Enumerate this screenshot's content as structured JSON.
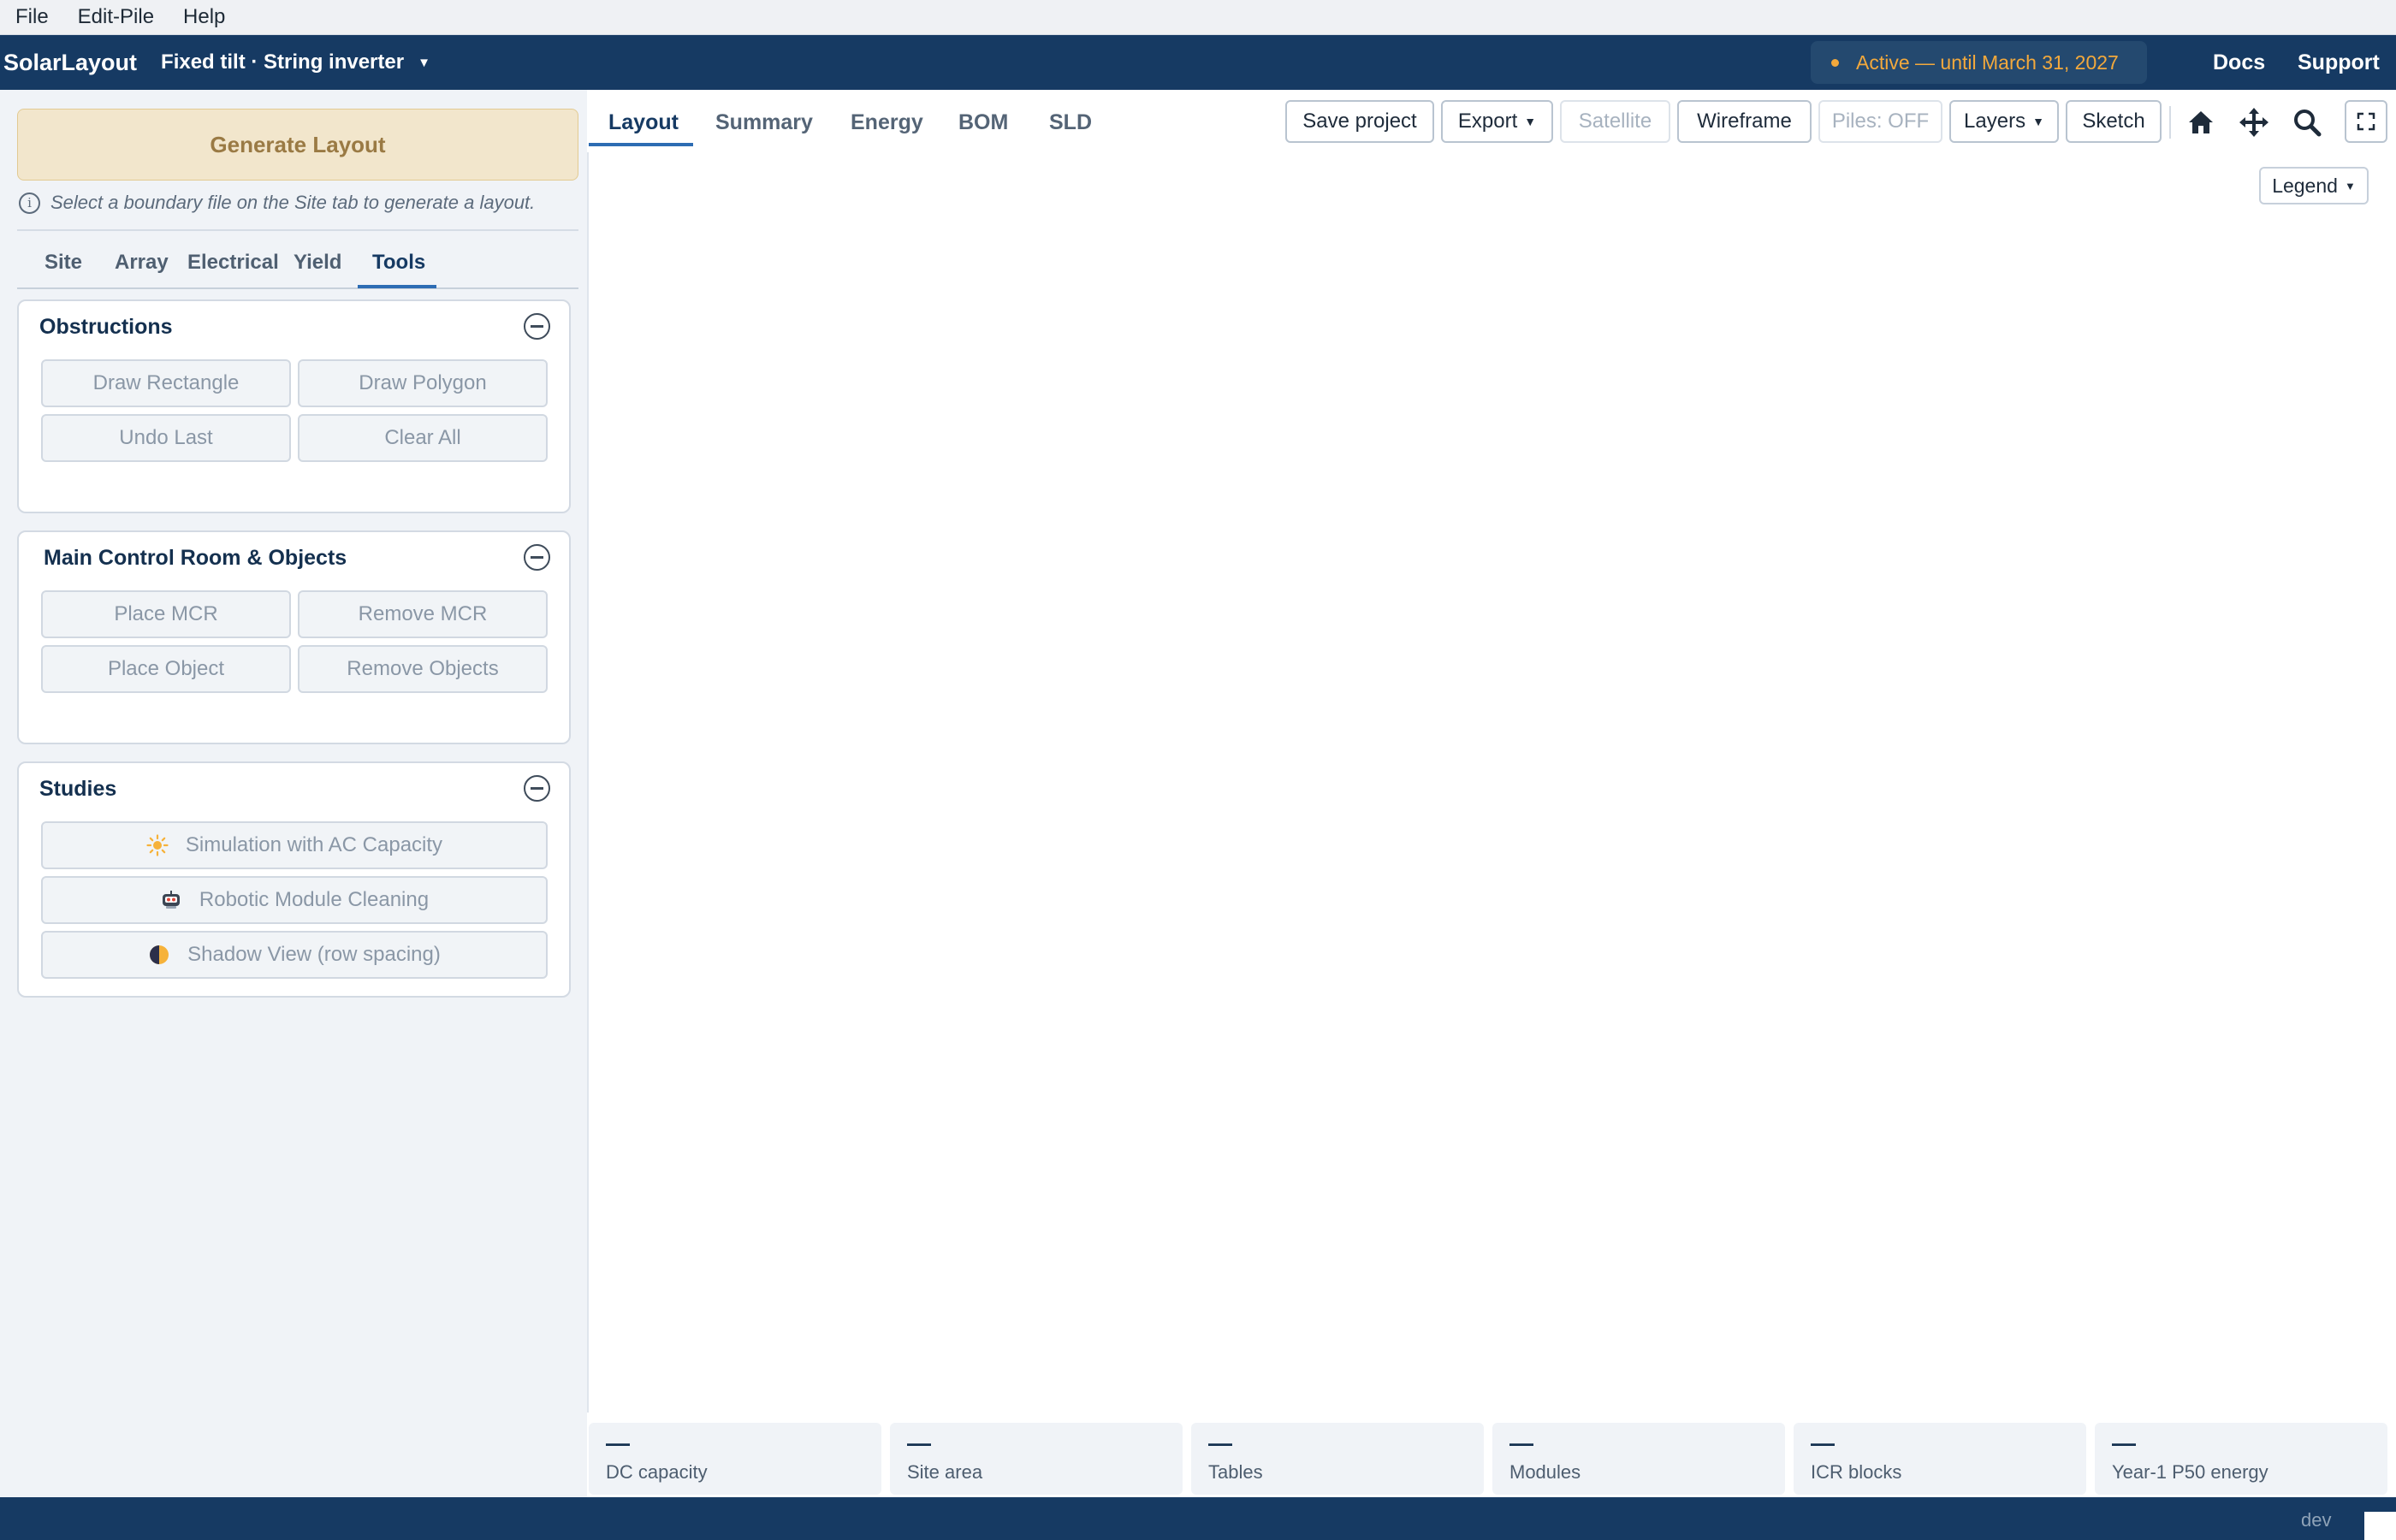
{
  "menu": [
    "File",
    "Edit-Pile",
    "Help"
  ],
  "header": {
    "brand": "SolarLayout",
    "mode": "Fixed tilt · String inverter",
    "license": "Active — until March 31, 2027",
    "docs": "Docs",
    "support": "Support",
    "accent": "#f3a93c",
    "bar_color": "#163a63"
  },
  "left": {
    "generate": "Generate Layout",
    "hint": "Select a boundary file on the Site tab to generate a layout.",
    "tabs": [
      "Site",
      "Array",
      "Electrical",
      "Yield",
      "Tools"
    ],
    "active_tab": "Tools",
    "obstructions": {
      "title": "Obstructions",
      "buttons": [
        "Draw Rectangle",
        "Draw Polygon",
        "Undo Last",
        "Clear All"
      ]
    },
    "mcr": {
      "title": "Main Control Room & Objects",
      "buttons": [
        "Place MCR",
        "Remove MCR",
        "Place Object",
        "Remove Objects"
      ]
    },
    "studies": {
      "title": "Studies",
      "items": [
        {
          "label": "Simulation with AC Capacity",
          "icon": "sun-icon"
        },
        {
          "label": "Robotic Module Cleaning",
          "icon": "robot-icon"
        },
        {
          "label": "Shadow View (row spacing)",
          "icon": "half-moon-icon"
        }
      ]
    }
  },
  "tabs": [
    "Layout",
    "Summary",
    "Energy",
    "BOM",
    "SLD"
  ],
  "active_tab": "Layout",
  "toolbar": {
    "save": "Save project",
    "export": "Export",
    "satellite": "Satellite",
    "wireframe": "Wireframe",
    "piles": "Piles: OFF",
    "layers": "Layers",
    "sketch": "Sketch",
    "icons": [
      "home-icon",
      "move-icon",
      "search-icon",
      "fullscreen-icon"
    ]
  },
  "legend": "Legend",
  "stats": [
    {
      "value": "—",
      "label": "DC capacity"
    },
    {
      "value": "—",
      "label": "Site area"
    },
    {
      "value": "—",
      "label": "Tables"
    },
    {
      "value": "—",
      "label": "Modules"
    },
    {
      "value": "—",
      "label": "ICR blocks"
    },
    {
      "value": "—",
      "label": "Year-1 P50 energy"
    }
  ],
  "footer": {
    "env": "dev"
  }
}
